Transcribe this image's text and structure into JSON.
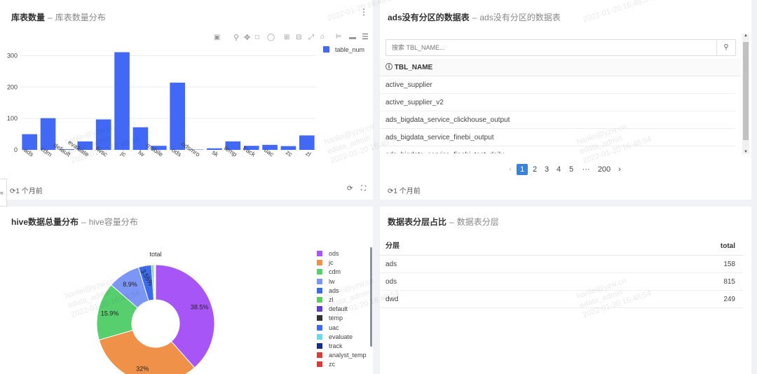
{
  "panels": {
    "bar": {
      "title": "库表数量",
      "sep": "–",
      "subtitle": "库表数量分布",
      "updated": "1 个月前",
      "legend": "table_num"
    },
    "list": {
      "title": "ads没有分区的数据表",
      "sep": "–",
      "subtitle": "ads没有分区的数据表",
      "updated": "1 个月前",
      "search_placeholder": "搜索 TBL_NAME...",
      "column": "TBL_NAME",
      "rows": [
        "active_supplier",
        "active_supplier_v2",
        "ads_bigdata_service_clickhouse_output",
        "ads_bigdata_service_finebi_output",
        "ads_bigdata_service_finebi_test_daily"
      ],
      "pages": [
        "1",
        "2",
        "3",
        "4",
        "5",
        "···",
        "200"
      ],
      "current_page": "1"
    },
    "pie": {
      "title": "hive数据总量分布",
      "sep": "–",
      "subtitle": "hive容量分布",
      "center_label": "total"
    },
    "layer": {
      "title": "数据表分层占比",
      "sep": "–",
      "subtitle": "数据表分层",
      "col_layer": "分层",
      "col_total": "total",
      "rows": [
        {
          "layer": "ads",
          "total": "158"
        },
        {
          "layer": "ods",
          "total": "815"
        },
        {
          "layer": "dwd",
          "total": "249"
        }
      ]
    }
  },
  "watermark": {
    "user": "hanlei@yzw.cn",
    "account": "edata_admin",
    "time": "2022-01-20 16:48:54"
  },
  "chart_data": [
    {
      "type": "bar",
      "categories": [
        "ads",
        "cdm",
        "default",
        "evaluate",
        "fwsc",
        "jc",
        "lw",
        "mobile",
        "ods",
        "odsmro",
        "sk",
        "temp",
        "track",
        "uac",
        "zc",
        "zl"
      ],
      "series": [
        {
          "name": "table_num",
          "values": [
            50,
            101,
            2,
            27,
            97,
            311,
            72,
            13,
            214,
            1,
            5,
            27,
            13,
            16,
            12,
            46
          ]
        }
      ],
      "ylim": [
        0,
        330
      ],
      "yticks": [
        0,
        100,
        200,
        300
      ],
      "color": "#4169f5"
    },
    {
      "type": "pie",
      "center_label": "total",
      "legend": [
        "ods",
        "jc",
        "cdm",
        "lw",
        "ads",
        "zl",
        "default",
        "temp",
        "uac",
        "evaluate",
        "track",
        "analyst_temp",
        "zc"
      ],
      "colors": [
        "#a855f7",
        "#f0914a",
        "#58cf6e",
        "#7b96f5",
        "#3b6bea",
        "#57cf5a",
        "#5c3fd1",
        "#333333",
        "#4169f5",
        "#69d9f0",
        "#1a2a8c",
        "#d93a3a",
        "#d93a3a"
      ],
      "values": [
        38.5,
        32,
        15.9,
        8.9,
        3.55,
        0.5,
        0.3,
        0.1,
        0.1,
        0.05,
        0.05,
        0.03,
        0.02
      ],
      "labels": [
        "38.5%",
        "32%",
        "15.9%",
        "8.9%",
        "3.55%",
        "",
        "",
        "",
        "",
        "",
        "",
        "",
        ""
      ]
    }
  ]
}
